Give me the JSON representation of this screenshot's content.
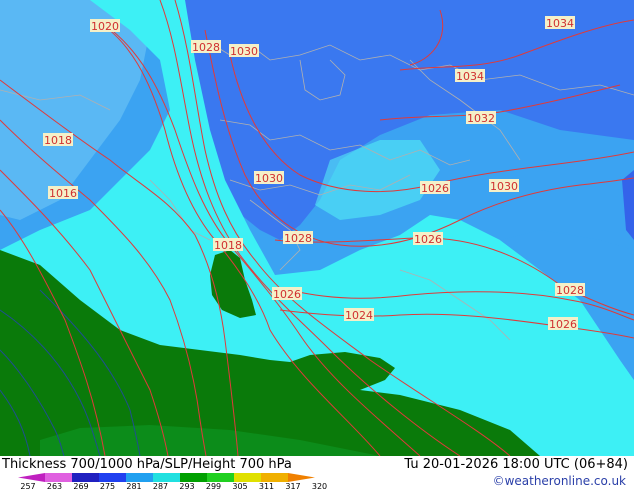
{
  "map": {
    "isobar_labels": [
      "1020",
      "1028",
      "1030",
      "1034",
      "1034",
      "1032",
      "1018",
      "1016",
      "1030",
      "1026",
      "1030",
      "1018",
      "1028",
      "1026",
      "1028",
      "1026",
      "1024",
      "1026"
    ],
    "colors": {
      "sea_dark_blue": "#3a78f0",
      "sea_mid_blue": "#3ba3f2",
      "cyan": "#3df0f5",
      "light_cyan": "#55f4f5",
      "green": "#0a7a0a",
      "isobar": "#e03a3a",
      "contour": "#1f4f8f",
      "border": "#a0a0a0"
    }
  },
  "footer": {
    "title": "Thickness 700/1000 hPa/SLP/Height 700 hPa",
    "datetime": "Tu 20-01-2026 18:00 UTC (06+84)",
    "credit": "©weatheronline.co.uk",
    "scale_ticks": [
      "257",
      "263",
      "269",
      "275",
      "281",
      "287",
      "293",
      "299",
      "305",
      "311",
      "317",
      "320"
    ],
    "scale_colors": [
      "#c020c0",
      "#e060e0",
      "#2020c0",
      "#2040f0",
      "#20a0f0",
      "#20e0e0",
      "#00a000",
      "#20d020",
      "#e0e000",
      "#f0b000",
      "#f08000"
    ]
  }
}
